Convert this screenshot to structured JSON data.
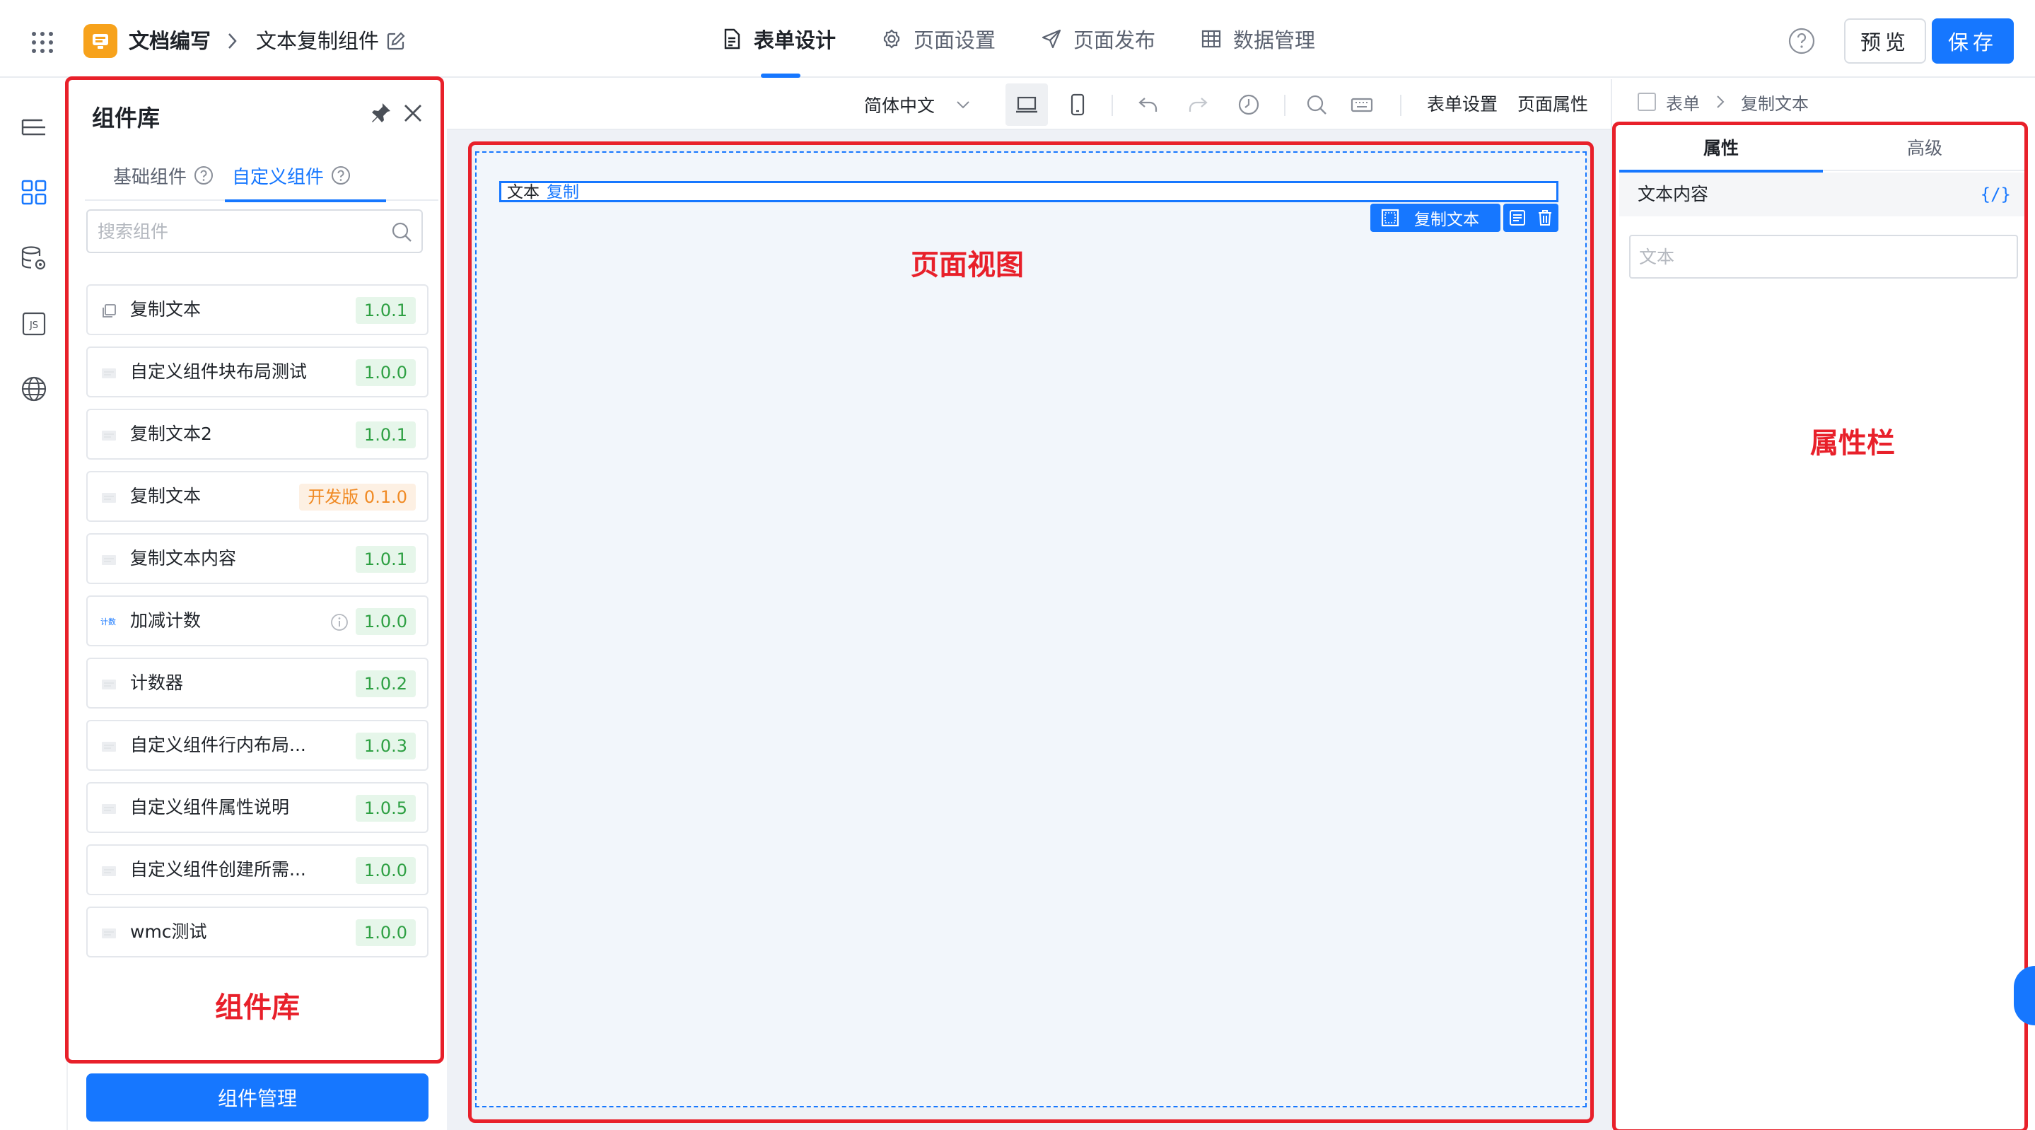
{
  "header": {
    "app_name": "文档编写",
    "page_name": "文本复制组件",
    "tabs": [
      {
        "label": "表单设计",
        "icon": "form-doc-icon",
        "active": true
      },
      {
        "label": "页面设置",
        "icon": "gear-icon",
        "active": false
      },
      {
        "label": "页面发布",
        "icon": "send-icon",
        "active": false
      },
      {
        "label": "数据管理",
        "icon": "table-grid-icon",
        "active": false
      }
    ],
    "preview_label": "预览",
    "save_label": "保存"
  },
  "left_rail": {
    "icons": [
      "outline-tree-icon",
      "components-grid-icon",
      "database-gear-icon",
      "js-icon",
      "globe-icon"
    ]
  },
  "component_library": {
    "title": "组件库",
    "tabs": [
      {
        "label": "基础组件",
        "active": false
      },
      {
        "label": "自定义组件",
        "active": true
      }
    ],
    "search_placeholder": "搜索组件",
    "items": [
      {
        "name": "复制文本",
        "version": "1.0.1",
        "dev": false
      },
      {
        "name": "自定义组件块布局测试",
        "version": "1.0.0",
        "dev": false
      },
      {
        "name": "复制文本2",
        "version": "1.0.1",
        "dev": false
      },
      {
        "name": "复制文本",
        "version": "开发版 0.1.0",
        "dev": true
      },
      {
        "name": "复制文本内容",
        "version": "1.0.1",
        "dev": false
      },
      {
        "name": "加减计数",
        "version": "1.0.0",
        "dev": false,
        "info": true,
        "icon_text": "计数"
      },
      {
        "name": "计数器",
        "version": "1.0.2",
        "dev": false
      },
      {
        "name": "自定义组件行内布局...",
        "version": "1.0.3",
        "dev": false
      },
      {
        "name": "自定义组件属性说明",
        "version": "1.0.5",
        "dev": false
      },
      {
        "name": "自定义组件创建所需...",
        "version": "1.0.0",
        "dev": false
      },
      {
        "name": "wmc测试",
        "version": "1.0.0",
        "dev": false
      }
    ],
    "annotation": "组件库",
    "manage_button": "组件管理"
  },
  "toolbar": {
    "language": "简体中文",
    "form_settings": "表单设置",
    "page_properties": "页面属性"
  },
  "canvas": {
    "text_label": "文本",
    "copy_link": "复制",
    "selected_tag": "复制文本",
    "annotation": "页面视图"
  },
  "properties": {
    "breadcrumb": [
      "表单",
      "复制文本"
    ],
    "tabs": [
      {
        "label": "属性",
        "active": true
      },
      {
        "label": "高级",
        "active": false
      }
    ],
    "section_label": "文本内容",
    "code_toggle": "{/}",
    "text_input_placeholder": "文本",
    "annotation": "属性栏"
  },
  "colors": {
    "primary": "#1677ff",
    "annotation_red": "#e8202a",
    "version_green": "#2ea043",
    "dev_orange": "#f08a24",
    "app_logo": "#f7a21b"
  }
}
